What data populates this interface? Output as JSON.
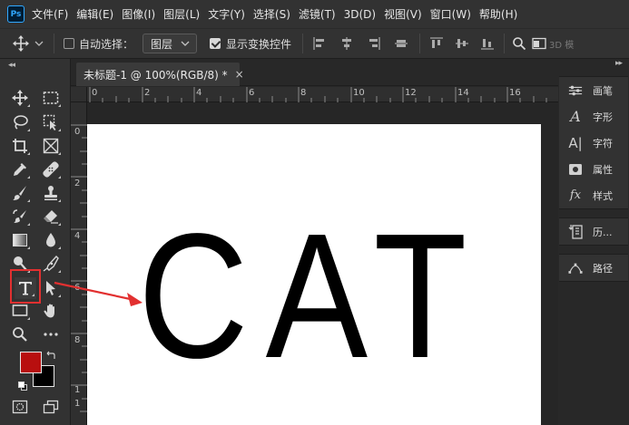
{
  "app": {
    "logo_text": "Ps"
  },
  "menu": {
    "items": [
      "文件(F)",
      "编辑(E)",
      "图像(I)",
      "图层(L)",
      "文字(Y)",
      "选择(S)",
      "滤镜(T)",
      "3D(D)",
      "视图(V)",
      "窗口(W)",
      "帮助(H)"
    ]
  },
  "options": {
    "auto_select_label": "自动选择：",
    "auto_select_checked": false,
    "layer_select_value": "图层",
    "show_transform_label": "显示变换控件",
    "show_transform_checked": true,
    "mode_3d_label": "3D 模"
  },
  "document": {
    "tab_title": "未标题-1 @ 100%(RGB/8) *",
    "close_glyph": "×",
    "canvas_text": "CAT",
    "ruler_h_labels": [
      "0",
      "2",
      "4",
      "6",
      "8",
      "10",
      "12",
      "14",
      "16"
    ],
    "ruler_v_labels": [
      "0",
      "2",
      "4",
      "6",
      "8",
      "1",
      "1"
    ]
  },
  "colors": {
    "foreground": "#b80f0f",
    "background": "#000000",
    "highlight": "#e23030"
  },
  "toolbar": {
    "active_tool": "horizontal-type-tool"
  },
  "panels": {
    "items": [
      "画笔",
      "字形",
      "字符",
      "属性",
      "样式",
      "历...",
      "路径"
    ]
  }
}
